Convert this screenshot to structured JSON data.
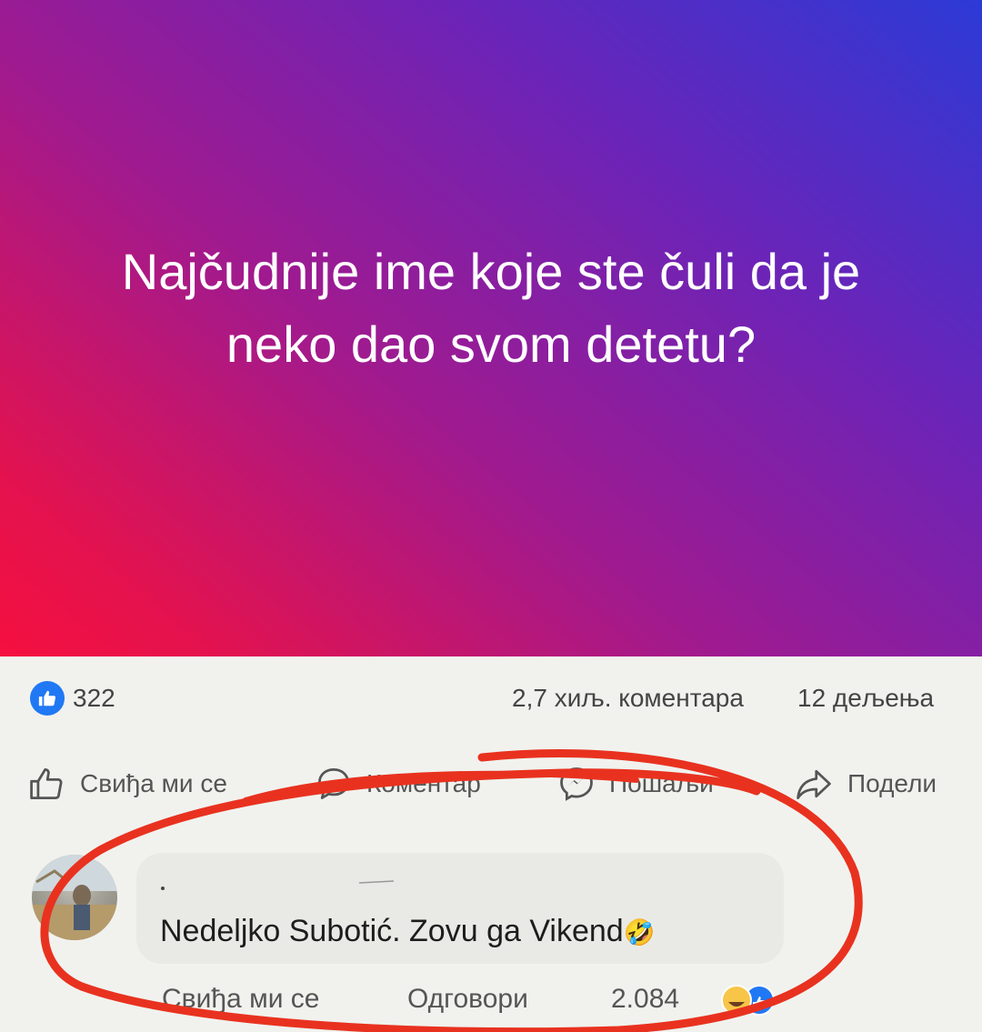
{
  "post": {
    "question": "Najčudnije ime koje ste čuli da je neko dao svom detetu?",
    "gradient_colors": [
      "#2c3ad6",
      "#a11a8e",
      "#f5103f"
    ]
  },
  "stats": {
    "likes": "322",
    "comments": "2,7 хиљ. коментара",
    "shares": "12 дељења"
  },
  "actions": {
    "like": "Свиђа ми се",
    "comment": "Коментар",
    "send": "Пошаљи",
    "share": "Подели"
  },
  "comment": {
    "text": "Nedeljko Subotić. Zovu ga Vikend",
    "emoji": "🤣",
    "like_label": "Свиђа ми се",
    "reply_label": "Одговори",
    "reaction_count": "2.084"
  },
  "colors": {
    "annotation": "#e8321f",
    "like_blue": "#2078f4"
  }
}
